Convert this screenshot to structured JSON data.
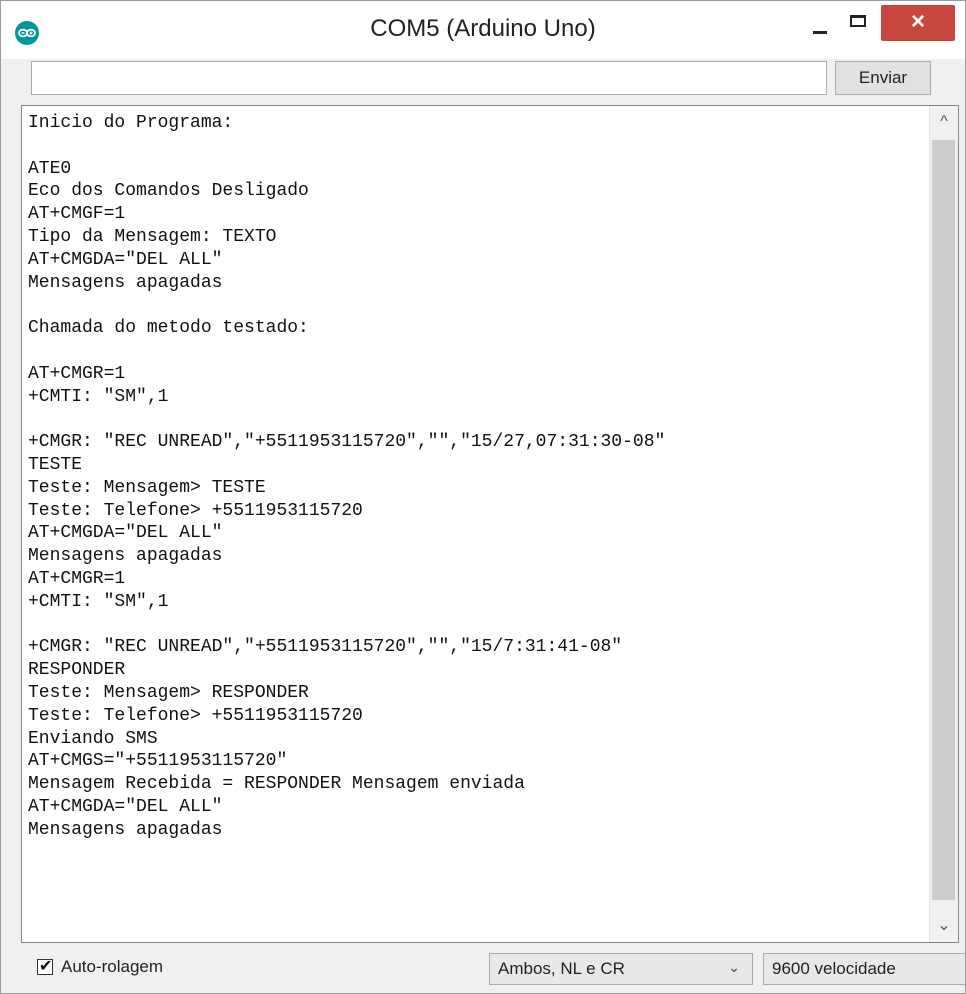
{
  "window": {
    "title": "COM5 (Arduino Uno)",
    "icon": "arduino-logo-icon",
    "controls": {
      "minimize": "minimize-icon",
      "maximize": "maximize-icon",
      "close": "close-icon"
    }
  },
  "toolbar": {
    "input_value": "",
    "send_label": "Enviar"
  },
  "console": {
    "lines": [
      "Inicio do Programa:",
      "",
      "ATE0",
      "Eco dos Comandos Desligado",
      "AT+CMGF=1",
      "Tipo da Mensagem: TEXTO",
      "AT+CMGDA=\"DEL ALL\"",
      "Mensagens apagadas",
      "",
      "Chamada do metodo testado:",
      "",
      "AT+CMGR=1",
      "+CMTI: \"SM\",1",
      "",
      "+CMGR: \"REC UNREAD\",\"+5511953115720\",\"\",\"15/27,07:31:30-08\"",
      "TESTE",
      "Teste: Mensagem> TESTE",
      "Teste: Telefone> +5511953115720",
      "AT+CMGDA=\"DEL ALL\"",
      "Mensagens apagadas",
      "AT+CMGR=1",
      "+CMTI: \"SM\",1",
      "",
      "+CMGR: \"REC UNREAD\",\"+5511953115720\",\"\",\"15/7:31:41-08\"",
      "RESPONDER",
      "Teste: Mensagem> RESPONDER",
      "Teste: Telefone> +5511953115720",
      "Enviando SMS",
      "AT+CMGS=\"+5511953115720\"",
      "Mensagem Recebida = RESPONDER Mensagem enviada",
      "AT+CMGDA=\"DEL ALL\"",
      "Mensagens apagadas"
    ]
  },
  "statusbar": {
    "autoscroll_label": "Auto-rolagem",
    "autoscroll_checked": true,
    "line_ending": "Ambos, NL e CR",
    "baud_rate": "9600 velocidade"
  },
  "colors": {
    "close_button": "#c7473f",
    "arduino_logo": "#00979c"
  }
}
